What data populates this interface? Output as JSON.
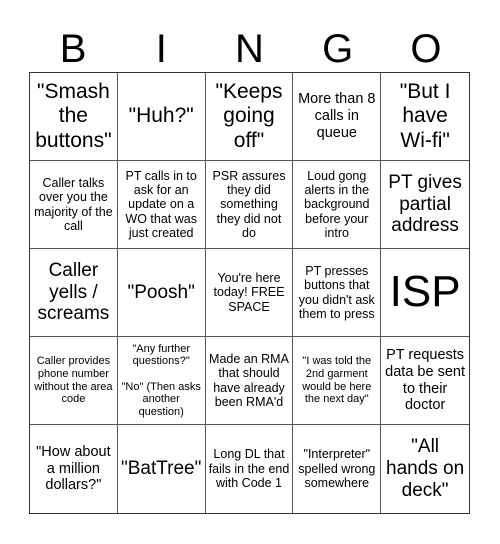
{
  "header": {
    "letters": [
      "B",
      "I",
      "N",
      "G",
      "O"
    ]
  },
  "cells": [
    "\"Smash the buttons\"",
    "\"Huh?\"",
    "\"Keeps going off\"",
    "More than 8 calls in queue",
    "\"But I have Wi-fi\"",
    "Caller talks over you the majority of the call",
    "PT calls in to ask for an update on a WO that was just created",
    "PSR assures they did something they did not do",
    "Loud gong alerts in the background before your intro",
    "PT gives partial address",
    "Caller yells / screams",
    "\"Poosh\"",
    "You're here today! FREE SPACE",
    "PT presses buttons that you didn't ask them to press",
    "ISP",
    "Caller provides phone number without the area code",
    "\"Any further questions?\"\n\n\"No\" (Then asks another question)",
    "Made an RMA that should have already been RMA'd",
    "\"I was told the 2nd garment would be here the next day\"",
    "PT requests data be sent to their doctor",
    "\"How about a million dollars?\"",
    "\"BatTree\"",
    "Long DL that fails in the end with Code 1",
    "\"Interpreter\" spelled wrong somewhere",
    "\"All hands on deck\""
  ]
}
